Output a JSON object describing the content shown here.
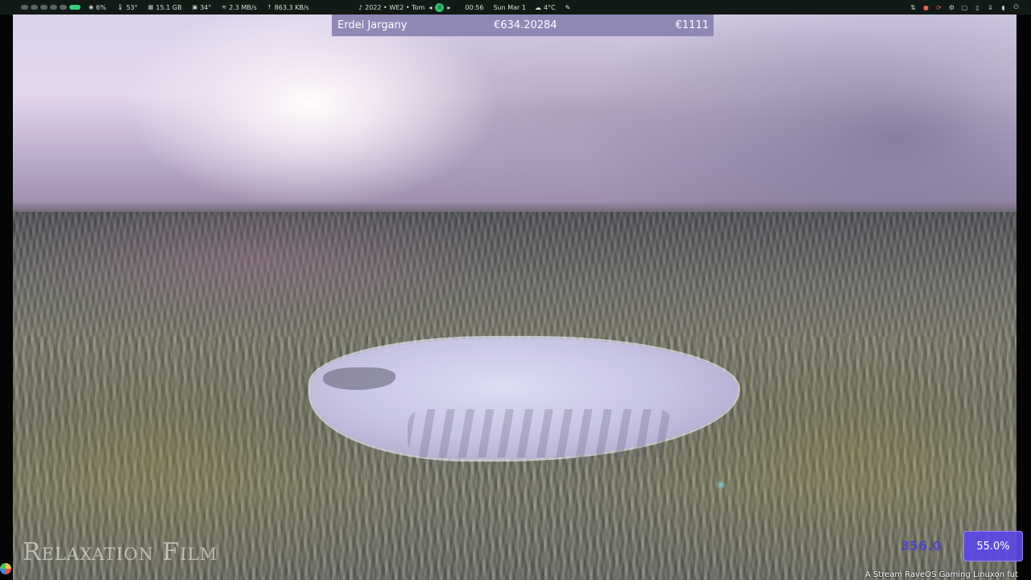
{
  "topbar": {
    "workspaces": [
      {
        "active": false
      },
      {
        "active": false
      },
      {
        "active": false
      },
      {
        "active": false
      },
      {
        "active": false
      },
      {
        "active": true
      }
    ],
    "stats": {
      "cpu": "6%",
      "cpu_temp": "53°",
      "memory": "15.1 GB",
      "gpu_temp": "34°",
      "download": "2.3 MB/s",
      "upload": "863.3 KB/s"
    },
    "media": "2022 • WE2 • Tom",
    "media_pause": "II",
    "clock": "00:56",
    "date": "Sun Mar 1",
    "weather": "4°C"
  },
  "ticker": {
    "name": "Erdei Jargany",
    "price": "€634.20284",
    "amount": "€1111"
  },
  "video": {
    "watermark": "Relaxation Film"
  },
  "overlay": {
    "number": "356.0",
    "progress": "55.0%",
    "progress_value": 0.55,
    "marquee": "A Stream RaveOS Gaming Linuxon fut"
  },
  "colors": {
    "accent_green": "#33d17a",
    "ticker_bg": "#8a82b2",
    "progress_bg": "#5c48e6"
  }
}
